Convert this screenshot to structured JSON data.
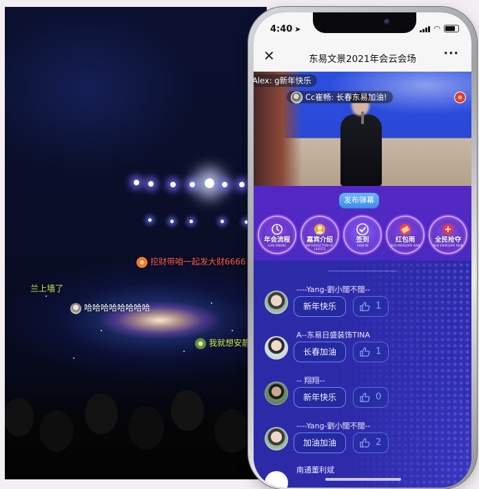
{
  "stage": {
    "danmaku": [
      {
        "text": "挖财带咱一起发大财6666",
        "color": "#ff5a54"
      },
      {
        "text": "兰上墙了",
        "color": "#cfe95a"
      },
      {
        "text": "哈哈哈哈哈哈哈哈",
        "color": "#ffffff"
      },
      {
        "text": "我就想安静",
        "color": "#cfe95a"
      }
    ]
  },
  "status": {
    "time": "4:40"
  },
  "titlebar": {
    "title": "东易文景2021年会云会场",
    "close_glyph": "✕",
    "more_glyph": "···"
  },
  "video": {
    "danmaku": [
      {
        "text": "Alex: g新年快乐"
      },
      {
        "text": "Cc崔畅: 长春东易加油!"
      }
    ]
  },
  "panel": {
    "danmu_button": "发布弹幕",
    "menu": [
      {
        "label": "年会流程",
        "sub": "LIVE ONLINE",
        "icon": "clock-icon"
      },
      {
        "label": "嘉宾介绍",
        "sub": "INTRODUCTION OF GUESTS",
        "icon": "person-icon"
      },
      {
        "label": "签到",
        "sub": "SIGN IN",
        "icon": "check-icon"
      },
      {
        "label": "红包雨",
        "sub": "RED ENVELOPE RAIN",
        "icon": "red-envelope-icon"
      },
      {
        "label": "全民抢夺",
        "sub": "RED ENVELOPE RAIN",
        "icon": "grab-icon"
      }
    ]
  },
  "comments": [
    {
      "name": "----Yang-劉小闊不闊--",
      "text": "新年快乐",
      "likes": "1"
    },
    {
      "name": "A--东易日盛装饰TINA",
      "text": "长春加油",
      "likes": "1"
    },
    {
      "name": "-- 翔翔--",
      "text": "新年快乐",
      "likes": "0"
    },
    {
      "name": "----Yang-劉小闊不闊--",
      "text": "加油加油",
      "likes": "2"
    },
    {
      "name": "南通董利斌",
      "text": "",
      "likes": ""
    }
  ],
  "colors": {
    "accent": "#3f8eea",
    "purple": "#5527c4",
    "comment_bg": "#2d2aa8"
  }
}
